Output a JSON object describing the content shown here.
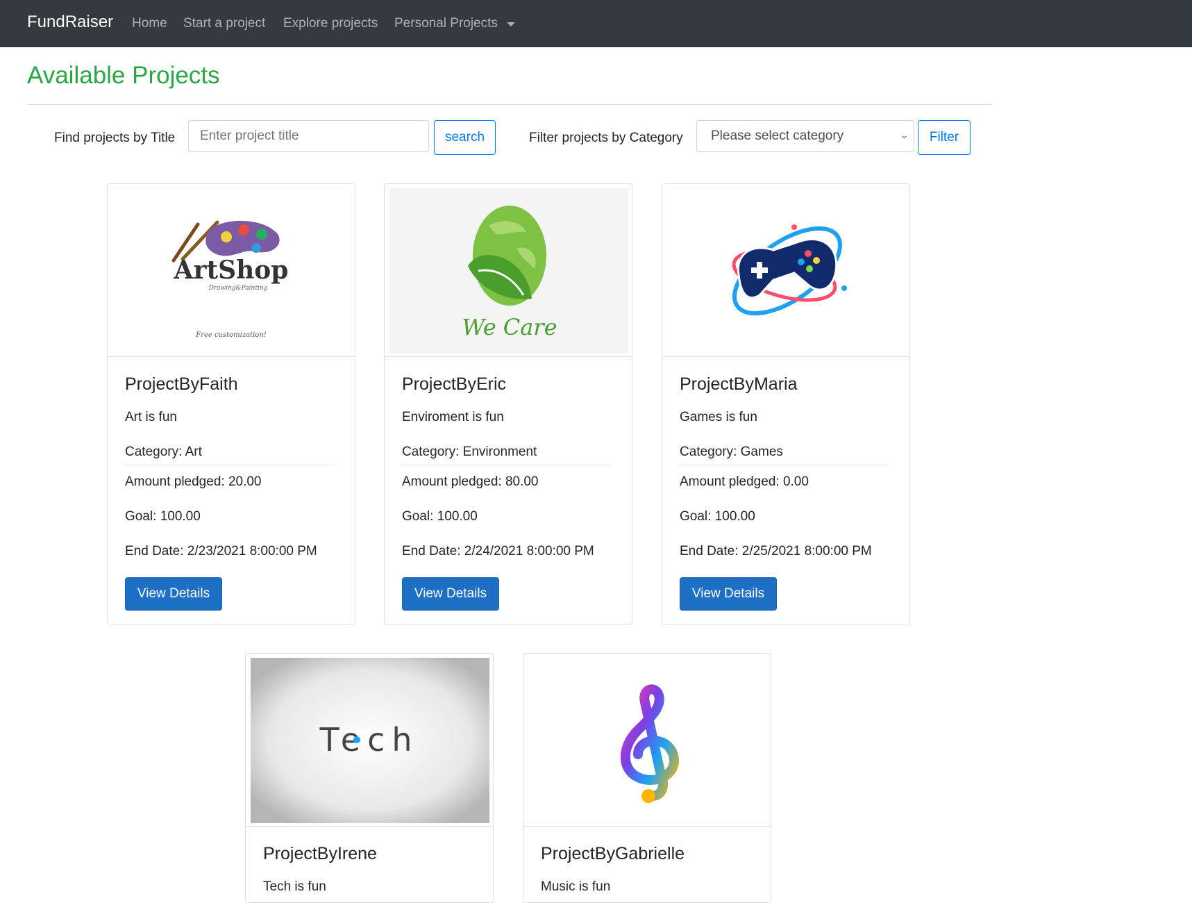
{
  "navbar": {
    "brand": "FundRaiser",
    "links": [
      "Home",
      "Start a project",
      "Explore projects",
      "Personal Projects"
    ]
  },
  "page": {
    "title": "Available Projects",
    "search_label": "Find projects by Title",
    "search_placeholder": "Enter project title",
    "search_button": "search",
    "filter_label": "Filter projects by Category",
    "category_select": "Please select category",
    "filter_button": "Filter"
  },
  "projects": [
    {
      "title": "ProjectByFaith",
      "description": "Art is fun",
      "category": "Category: Art",
      "pledged": "Amount pledged: 20.00",
      "goal": "Goal: 100.00",
      "end_date": "End Date: 2/23/2021 8:00:00 PM",
      "button": "View Details",
      "logo_text": "ArtShop",
      "logo_subtext": "Drawing&Painting",
      "logo_caption": "Free customization!"
    },
    {
      "title": "ProjectByEric",
      "description": "Enviroment is fun",
      "category": "Category: Environment",
      "pledged": "Amount pledged: 80.00",
      "goal": "Goal: 100.00",
      "end_date": "End Date: 2/24/2021 8:00:00 PM",
      "button": "View Details",
      "logo_text": "We Care"
    },
    {
      "title": "ProjectByMaria",
      "description": "Games is fun",
      "category": "Category: Games",
      "pledged": "Amount pledged: 0.00",
      "goal": "Goal: 100.00",
      "end_date": "End Date: 2/25/2021 8:00:00 PM",
      "button": "View Details"
    },
    {
      "title": "ProjectByIrene",
      "description": "Tech is fun",
      "logo_text": "Tech"
    },
    {
      "title": "ProjectByGabrielle",
      "description": "Music is fun"
    }
  ],
  "colors": {
    "navbar_bg": "#343a40",
    "title_green": "#28a745",
    "primary_blue": "#1e6fc6",
    "outline_blue": "#007bff"
  }
}
